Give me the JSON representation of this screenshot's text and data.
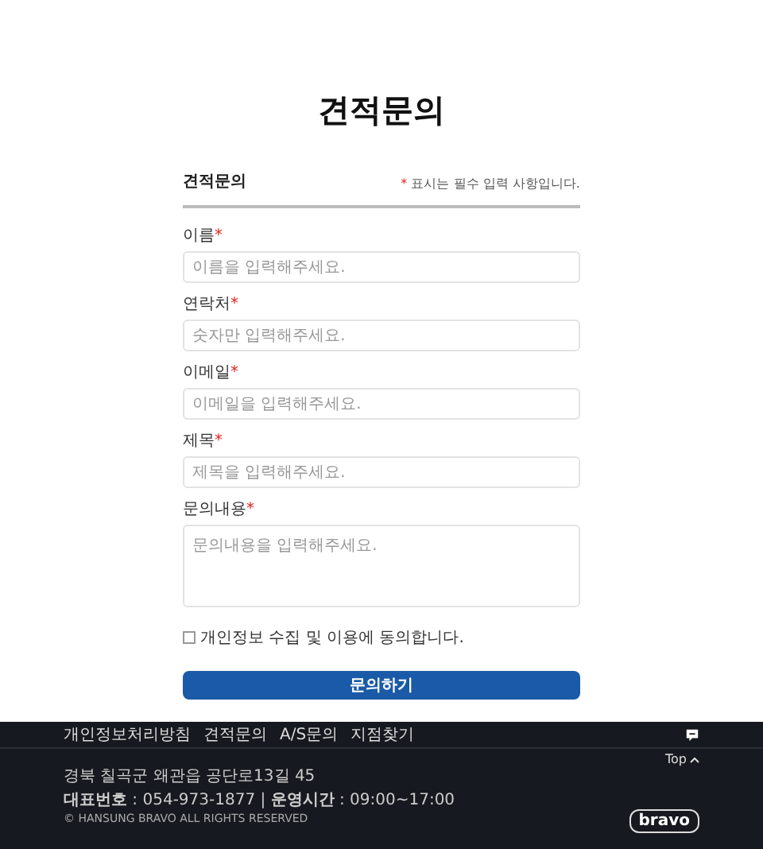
{
  "page_title": "견적문의",
  "form": {
    "title": "견적문의",
    "required_note_mark": "*",
    "required_note": "표시는 필수 입력 사항입니다.",
    "fields": [
      {
        "kind": "input",
        "label": "이름",
        "required_mark": "*",
        "placeholder": "이름을 입력해주세요."
      },
      {
        "kind": "input",
        "label": "연락처",
        "required_mark": "*",
        "placeholder": "숫자만 입력해주세요."
      },
      {
        "kind": "input",
        "label": "이메일",
        "required_mark": "*",
        "placeholder": "이메일을 입력해주세요."
      },
      {
        "kind": "input",
        "label": "제목",
        "required_mark": "*",
        "placeholder": "제목을 입력해주세요."
      },
      {
        "kind": "textarea",
        "label": "문의내용",
        "required_mark": "*",
        "placeholder": "문의내용을 입력해주세요."
      }
    ],
    "consent": {
      "label": "개인정보 수집 및 이용에 동의합니다.",
      "checked": false
    },
    "submit": "문의하기"
  },
  "footer": {
    "links": [
      "개인정보처리방침",
      "견적문의",
      "A/S문의",
      "지점찾기"
    ],
    "top": "Top",
    "address": "경북 칠곡군 왜관읍 공단로13길 45",
    "contact": "**대표번호** : 054-973-1877 | **운영시간** : 09:00~17:00",
    "copyright": "© HANSUNG BRAVO ALL RIGHTS RESERVED",
    "logo": "bravo"
  }
}
